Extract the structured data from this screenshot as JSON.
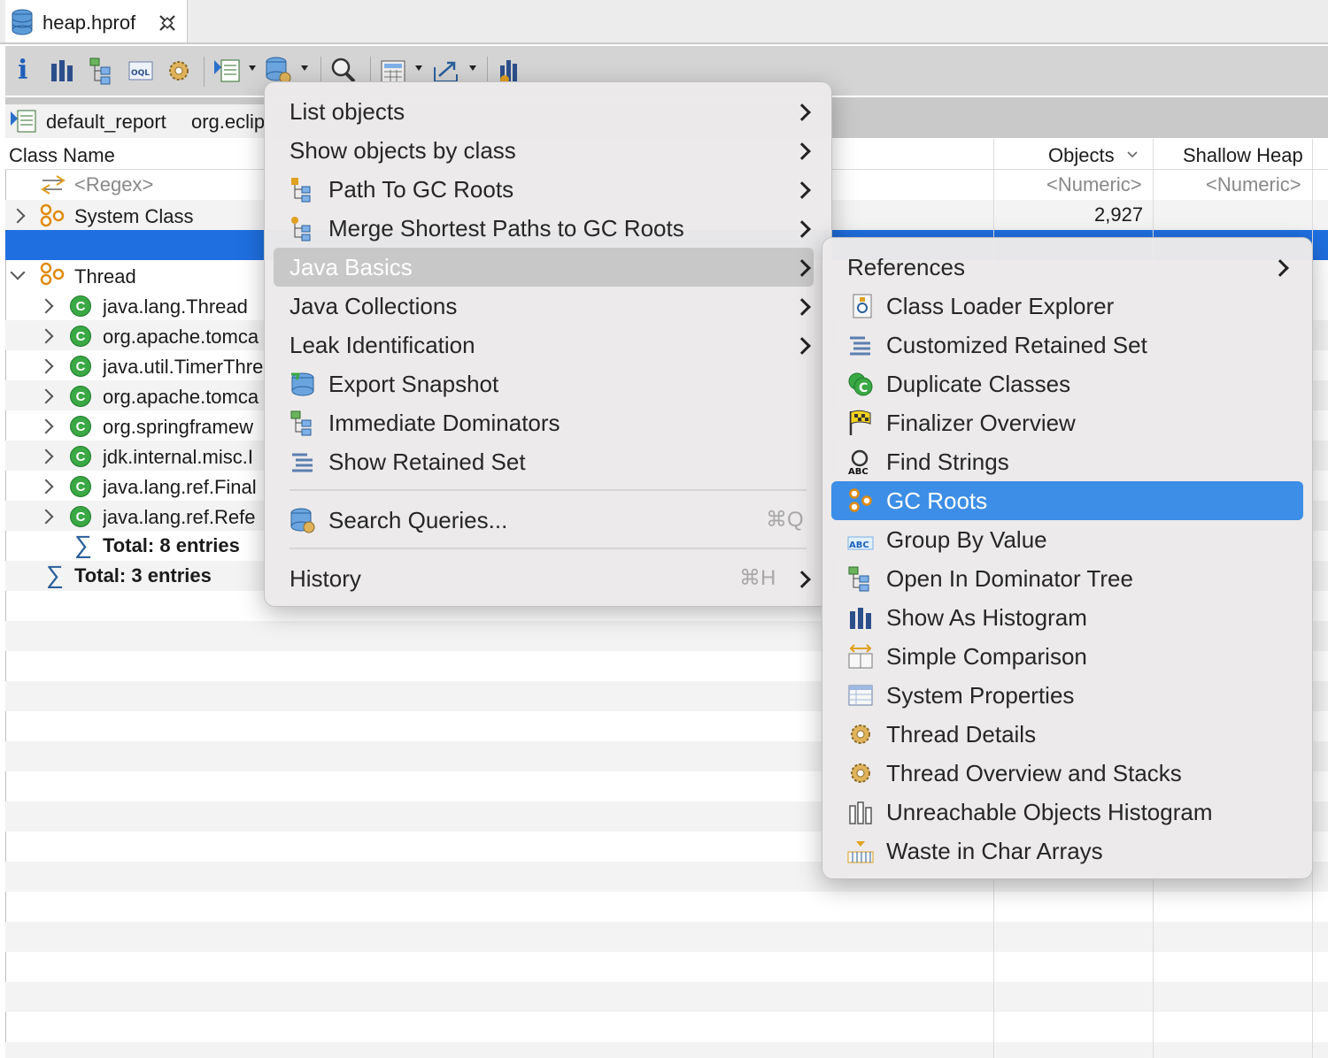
{
  "editor_tab": {
    "title": "heap.hprof"
  },
  "result_tab": {
    "report": "default_report",
    "path": "org.eclip"
  },
  "table": {
    "headers": {
      "class_name": "Class Name",
      "objects": "Objects",
      "shallow_heap": "Shallow Heap"
    },
    "filters": {
      "class_name": "<Regex>",
      "objects": "<Numeric>",
      "shallow_heap": "<Numeric>"
    },
    "rows": [
      {
        "label": "System Class",
        "objects": "2,927"
      },
      {
        "label": "Thread"
      },
      {
        "label": "java.lang.Thread"
      },
      {
        "label": "org.apache.tomca"
      },
      {
        "label": "java.util.TimerThre"
      },
      {
        "label": "org.apache.tomca"
      },
      {
        "label": "org.springframew"
      },
      {
        "label": "jdk.internal.misc.I"
      },
      {
        "label": "java.lang.ref.Final"
      },
      {
        "label": "java.lang.ref.Refe"
      },
      {
        "label": "Total: 8 entries"
      },
      {
        "label": "Total: 3 entries"
      }
    ]
  },
  "main_menu": {
    "items": [
      {
        "label": "List objects"
      },
      {
        "label": "Show objects by class"
      },
      {
        "label": "Path To GC Roots"
      },
      {
        "label": "Merge Shortest Paths to GC Roots"
      },
      {
        "label": "Java Basics"
      },
      {
        "label": "Java Collections"
      },
      {
        "label": "Leak Identification"
      },
      {
        "label": "Export Snapshot"
      },
      {
        "label": "Immediate Dominators"
      },
      {
        "label": "Show Retained Set"
      },
      {
        "label": "Search Queries...",
        "shortcut": "⌘Q"
      },
      {
        "label": "History",
        "shortcut": "⌘H"
      }
    ]
  },
  "sub_menu": {
    "items": [
      {
        "label": "References"
      },
      {
        "label": "Class Loader Explorer"
      },
      {
        "label": "Customized Retained Set"
      },
      {
        "label": "Duplicate Classes"
      },
      {
        "label": "Finalizer Overview"
      },
      {
        "label": "Find Strings"
      },
      {
        "label": "GC Roots"
      },
      {
        "label": "Group By Value"
      },
      {
        "label": "Open In Dominator Tree"
      },
      {
        "label": "Show As Histogram"
      },
      {
        "label": "Simple Comparison"
      },
      {
        "label": "System Properties"
      },
      {
        "label": "Thread Details"
      },
      {
        "label": "Thread Overview and Stacks"
      },
      {
        "label": "Unreachable Objects Histogram"
      },
      {
        "label": "Waste in Char Arrays"
      }
    ]
  },
  "colors": {
    "selection": "#1f6fe0",
    "menu_highlight": "#3d8ee6",
    "class_icon": "#3aa844"
  }
}
